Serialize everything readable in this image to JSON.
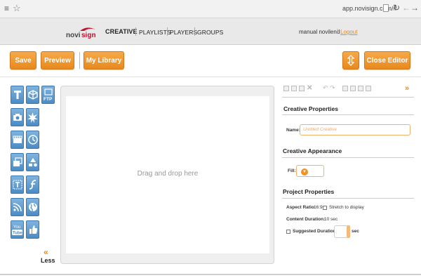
{
  "browser": {
    "url": "app.novisign.com/#",
    "icons": [
      "menu-icon",
      "star-icon",
      "page-icon",
      "reload-icon",
      "back-icon",
      "forward-icon"
    ]
  },
  "app": {
    "logo_text": "novisign",
    "nav": [
      "CREATIVE",
      "PLAYLISTS",
      "PLAYERS",
      "GROUPS"
    ],
    "active_nav": "CREATIVE",
    "user": "manual novilend",
    "separator": "|",
    "logout": "Logout"
  },
  "toolbar": {
    "save": "Save",
    "preview": "Preview",
    "library": "My Library",
    "close": "Close Editor"
  },
  "tools": {
    "ftp": "FTP",
    "tube_you": "You",
    "tube": "Tube",
    "icons": [
      "text-tool-icon",
      "3d-box-tool-icon",
      "ftp-tool-icon",
      "camera-tool-icon",
      "burst-tool-icon",
      "video-tool-icon",
      "clock-tool-icon",
      "slideshow-tool-icon",
      "shapes-tool-icon",
      "ticker-tool-icon",
      "flash-tool-icon",
      "rss-tool-icon",
      "web-tool-icon",
      "youtube-tool-icon",
      "facebook-tool-icon"
    ]
  },
  "less": {
    "arrow": "«",
    "label": "Less"
  },
  "canvas": {
    "placeholder": "Drag and drop here"
  },
  "panel": {
    "expand": "»",
    "creative_properties": "Creative Properties",
    "name_label": "Name:",
    "name_placeholder": "Untitled Creative",
    "creative_appearance": "Creative Appearance",
    "fill_label": "Fill:",
    "project_properties": "Project Properties",
    "aspect_label": "Aspect Ratio:",
    "aspect_value": "16:9",
    "stretch_label": "Stretch to display",
    "content_label": "Content Duration:",
    "content_value": "10 sec",
    "suggested_label": "Suggested Duration:",
    "sec_unit": "sec"
  },
  "colors": {
    "accent": "#e8891e",
    "tool_blue": "#4b8cc6"
  }
}
